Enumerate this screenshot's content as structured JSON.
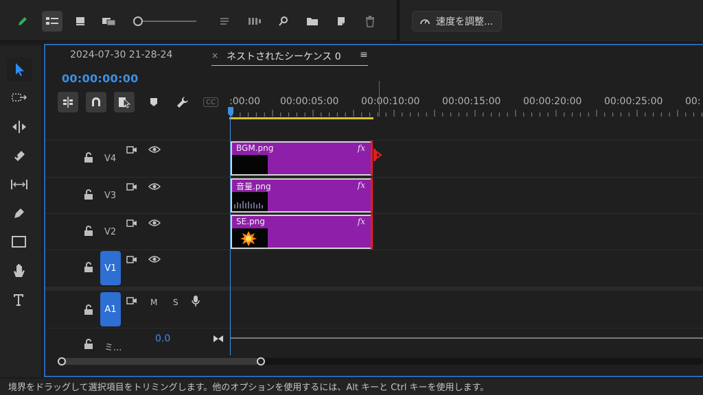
{
  "toolbar": {
    "icons": [
      "pen-icon",
      "list-view-icon",
      "icon-view-icon",
      "freeform-view-icon",
      "zoom-slider",
      "sort-icon",
      "automate-icon",
      "search-icon",
      "new-bin-icon",
      "new-item-icon",
      "trash-icon"
    ],
    "speed_button_label": "速度を調整..."
  },
  "tools": [
    "selection-tool",
    "track-select-tool",
    "ripple-edit-tool",
    "razor-tool",
    "slip-tool",
    "pen-tool",
    "rectangle-tool",
    "hand-tool",
    "type-tool"
  ],
  "timeline": {
    "tabs": [
      {
        "label": "2024-07-30 21-28-24"
      },
      {
        "label": "ネストされたシーケンス 0",
        "active": true
      }
    ],
    "tab_close": "×",
    "tab_menu": "≡",
    "timecode": "00:00:00:00",
    "header_buttons": [
      "nest-toggle",
      "snap-toggle",
      "linked-selection",
      "add-marker",
      "settings-wrench",
      "captions"
    ],
    "captions_label": "CC",
    "ruler_labels": [
      ":00:00",
      "00:00:05:00",
      "00:00:10:00",
      "00:00:15:00",
      "00:00:20:00",
      "00:00:25:00",
      "00:"
    ],
    "tracks": {
      "v4": "V4",
      "v3": "V3",
      "v2": "V2",
      "v1": "V1",
      "a1": "A1",
      "mute": "M",
      "solo": "S"
    },
    "clips": [
      {
        "name": "BGM.png",
        "fx": "fx"
      },
      {
        "name": "音量.png",
        "fx": "fx"
      },
      {
        "name": "SE.png",
        "fx": "fx"
      }
    ],
    "mix": {
      "value": "0.0",
      "name": "ミ..."
    }
  },
  "status_bar": "境界をドラッグして選択項目をトリミングします。他のオプションを使用するには、Alt キーと Ctrl キーを使用します。",
  "colors": {
    "accent_blue": "#2d6fd3",
    "clip_purple": "#8e1fa8",
    "work_area_yellow": "#d8c22a",
    "trim_red": "#e02020"
  }
}
